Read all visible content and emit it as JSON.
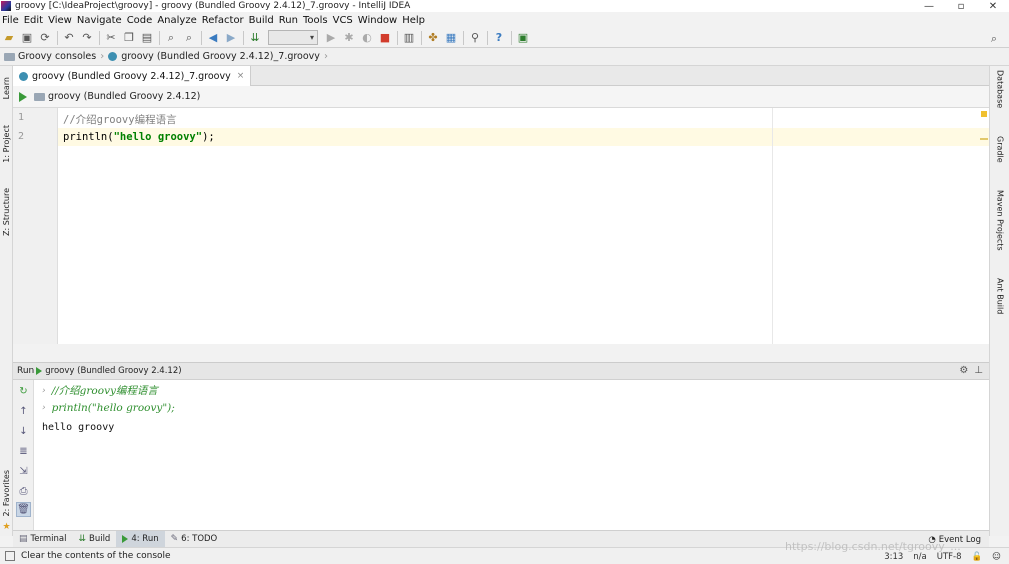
{
  "window": {
    "title": "groovy [C:\\IdeaProject\\groovy] - groovy (Bundled Groovy 2.4.12)_7.groovy - IntelliJ IDEA",
    "controls": [
      "—",
      "▫",
      "✕"
    ]
  },
  "menu": [
    "File",
    "Edit",
    "View",
    "Navigate",
    "Code",
    "Analyze",
    "Refactor",
    "Build",
    "Run",
    "Tools",
    "VCS",
    "Window",
    "Help"
  ],
  "toolbar": {
    "icons": [
      "open-folder-icon",
      "save-icon",
      "sync-icon",
      "undo-icon",
      "redo-icon",
      "cut-icon",
      "copy-icon",
      "paste-icon",
      "find-icon",
      "replace-icon",
      "back-icon",
      "forward-icon",
      "build-icon",
      "run-config-select",
      "run-icon",
      "debug-icon",
      "coverage-icon",
      "stop-icon",
      "project-structure-icon",
      "settings-icon",
      "sdk-icon",
      "vcs-icon",
      "help-icon",
      "terminal-icon"
    ],
    "select_value": "",
    "search_icon": "search-icon"
  },
  "breadcrumb": {
    "items": [
      "Groovy consoles",
      "groovy (Bundled Groovy 2.4.12)_7.groovy"
    ]
  },
  "left_tabs": [
    "Learn",
    "1: Project",
    "Z: Structure",
    "2: Favorites"
  ],
  "right_tabs": [
    "Database",
    "Gradle",
    "Maven Projects",
    "Ant Build"
  ],
  "editor_tab": {
    "label": "groovy (Bundled Groovy 2.4.12)_7.groovy",
    "close": "×"
  },
  "run_config": {
    "label": "groovy (Bundled Groovy 2.4.12)"
  },
  "editor": {
    "lines": [
      {
        "number": "1",
        "comment": "//介绍groovy编程语言"
      },
      {
        "number": "2",
        "fn": "println(",
        "string": "\"hello groovy\"",
        "end": ");"
      }
    ]
  },
  "run_panel": {
    "label": "Run",
    "config": "groovy (Bundled Groovy 2.4.12)",
    "console_lines": [
      {
        "kind": "input",
        "text": "//介绍groovy编程语言"
      },
      {
        "kind": "input",
        "text": "println(\"hello groovy\");"
      },
      {
        "kind": "output",
        "text": "hello groovy"
      }
    ]
  },
  "bottom_tabs": [
    {
      "label": "Terminal"
    },
    {
      "label": "Build"
    },
    {
      "label": "4: Run"
    },
    {
      "label": "6: TODO"
    }
  ],
  "event_log": "Event Log",
  "status": {
    "message": "Clear the contents of the console",
    "position": "3:13",
    "na": "n/a",
    "encoding": "UTF-8"
  },
  "watermark": "https://blog.csdn.net/tgroovy_...",
  "colors": {
    "string": "#008000",
    "comment": "#808080",
    "run_green": "#3a9a3a",
    "current_line": "#fffae3"
  }
}
